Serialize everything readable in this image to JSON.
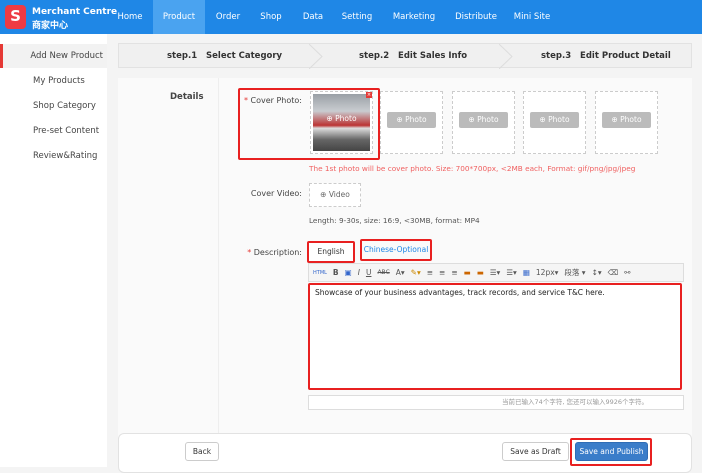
{
  "brand": {
    "logo_letter": "S",
    "name": "Merchant Centre",
    "name_cn": "商家中心"
  },
  "nav": [
    "Home",
    "Product",
    "Order",
    "Shop",
    "Data",
    "Setting",
    "Marketing",
    "Distribute",
    "Mini Site"
  ],
  "nav_active": "Product",
  "sidebar": [
    "Add New Product",
    "My Products",
    "Shop Category",
    "Pre-set Content",
    "Review&Rating"
  ],
  "steps": [
    {
      "num": "step.1",
      "label": "Select Category"
    },
    {
      "num": "step.2",
      "label": "Edit Sales Info"
    },
    {
      "num": "step.3",
      "label": "Edit Product Detail"
    }
  ],
  "form": {
    "section": "Details",
    "cover_photo_label": "Cover Photo:",
    "required_mark": "*",
    "photo_btn": "⊕ Photo",
    "photo_note": "The 1st photo will be cover photo. Size: 700*700px, <2MB each, Format: gif/png/jpg/jpeg",
    "cover_video_label": "Cover Video:",
    "video_btn": "⊕ Video",
    "video_note": "Length: 9-30s, size: 16:9, <30MB, format: MP4",
    "description_label": "Description:",
    "tabs": [
      "English",
      "Chinese-Optional"
    ],
    "toolbar": {
      "font_size": "12px",
      "paragraph": "段落"
    },
    "description_text": "Showcase of your business advantages, track records, and service T&C here.",
    "counter": "当前已输入74个字符, 您还可以输入9926个字符。"
  },
  "footer": {
    "back": "Back",
    "draft": "Save as Draft",
    "publish": "Save and Publish"
  },
  "colors": {
    "nav": "#1f87e6",
    "highlight": "#e82020",
    "publish": "#3a7dc9"
  }
}
